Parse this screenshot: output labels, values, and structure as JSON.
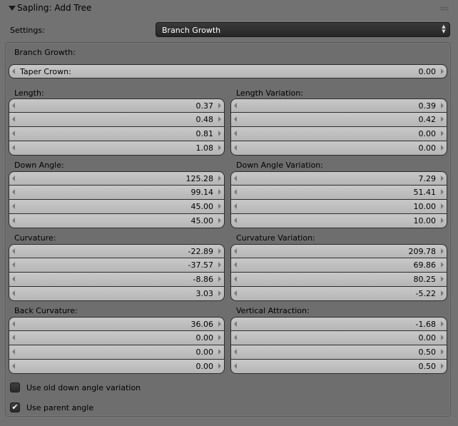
{
  "panel": {
    "title": "Sapling: Add Tree"
  },
  "settings": {
    "label": "Settings:",
    "value": "Branch Growth"
  },
  "section_title": "Branch Growth:",
  "taper_crown": {
    "label": "Taper Crown:",
    "value": "0.00"
  },
  "groups": {
    "length": {
      "label": "Length:",
      "values": [
        "0.37",
        "0.48",
        "0.81",
        "1.08"
      ]
    },
    "length_variation": {
      "label": "Length Variation:",
      "values": [
        "0.39",
        "0.42",
        "0.00",
        "0.00"
      ]
    },
    "down_angle": {
      "label": "Down Angle:",
      "values": [
        "125.28",
        "99.14",
        "45.00",
        "45.00"
      ]
    },
    "down_angle_variation": {
      "label": "Down Angle Variation:",
      "values": [
        "7.29",
        "51.41",
        "10.00",
        "10.00"
      ]
    },
    "curvature": {
      "label": "Curvature:",
      "values": [
        "-22.89",
        "-37.57",
        "-8.86",
        "3.03"
      ]
    },
    "curvature_variation": {
      "label": "Curvature Variation:",
      "values": [
        "209.78",
        "69.86",
        "80.25",
        "-5.22"
      ]
    },
    "back_curvature": {
      "label": "Back Curvature:",
      "values": [
        "36.06",
        "0.00",
        "0.00",
        "0.00"
      ]
    },
    "vertical_attraction": {
      "label": "Vertical Attraction:",
      "values": [
        "-1.68",
        "0.00",
        "0.50",
        "0.50"
      ]
    }
  },
  "checkboxes": [
    {
      "label": "Use old down angle variation",
      "checked": false,
      "mark": ""
    },
    {
      "label": "Use parent angle",
      "checked": true,
      "mark": "✔"
    }
  ]
}
